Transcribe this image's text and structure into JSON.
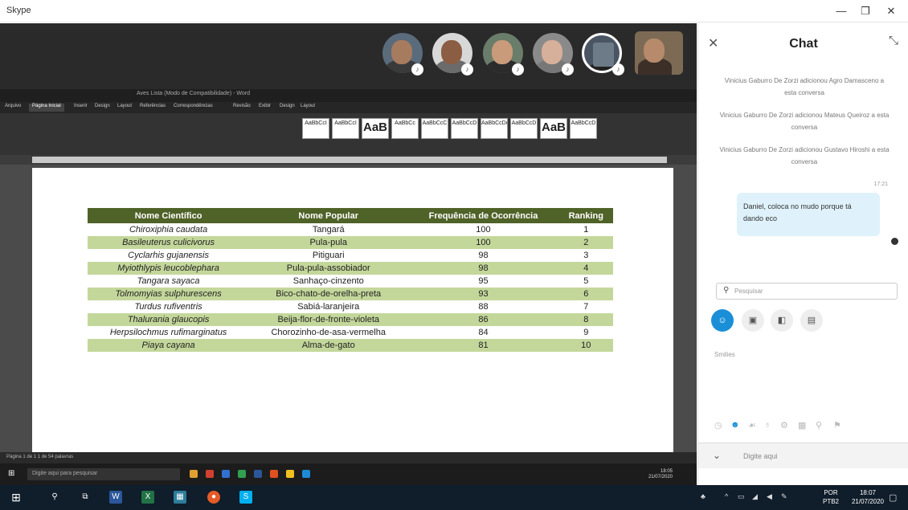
{
  "window": {
    "title": "Skype",
    "min": "—",
    "restore": "❐",
    "close": "✕"
  },
  "participants": [
    {
      "name": "participant-1",
      "active": false
    },
    {
      "name": "participant-2",
      "active": false
    },
    {
      "name": "participant-3",
      "active": false
    },
    {
      "name": "participant-4",
      "active": false
    },
    {
      "name": "participant-5",
      "active": true
    },
    {
      "name": "participant-6",
      "active": false
    }
  ],
  "word": {
    "title": "Aves Lista (Modo de Compatibilidade) - Word",
    "tabs": [
      "Arquivo",
      "Página Inicial",
      "Inserir",
      "Design",
      "Layout",
      "Referências",
      "Correspondências",
      "Revisão",
      "Exibir",
      "Design",
      "Layout"
    ],
    "styles": [
      "AaBbCcI",
      "AaBbCcI",
      "AaB",
      "AaBbCc",
      "AaBbCcC",
      "AaBbCcD",
      "AaBbCcDd",
      "AaBbCcD",
      "AaB",
      "AaBbCcD"
    ],
    "status": "Página 1 de 1   1 de 54 palavras",
    "taskbar_search": "Digite aqui para pesquisar",
    "time": "18:05",
    "date": "21/07/2020"
  },
  "table": {
    "headers": [
      "Nome Científico",
      "Nome Popular",
      "Frequência de Ocorrência",
      "Ranking"
    ],
    "rows": [
      [
        "Chiroxiphia caudata",
        "Tangará",
        "100",
        "1"
      ],
      [
        "Basileuterus culicivorus",
        "Pula-pula",
        "100",
        "2"
      ],
      [
        "Cyclarhis gujanensis",
        "Pitiguari",
        "98",
        "3"
      ],
      [
        "Myiothlypis leucoblephara",
        "Pula-pula-assobiador",
        "98",
        "4"
      ],
      [
        "Tangara sayaca",
        "Sanhaço-cinzento",
        "95",
        "5"
      ],
      [
        "Tolmomyias sulphurescens",
        "Bico-chato-de-orelha-preta",
        "93",
        "6"
      ],
      [
        "Turdus rufiventris",
        "Sabiá-laranjeira",
        "88",
        "7"
      ],
      [
        "Thalurania glaucopis",
        "Beija-flor-de-fronte-violeta",
        "86",
        "8"
      ],
      [
        "Herpsilochmus rufimarginatus",
        "Chorozinho-de-asa-vermelha",
        "84",
        "9"
      ],
      [
        "Piaya cayana",
        "Alma-de-gato",
        "81",
        "10"
      ]
    ]
  },
  "chat": {
    "title": "Chat",
    "system_messages": [
      "Vinicius Gaburro De Zorzi adicionou Agro Damasceno a esta conversa",
      "Vinicius Gaburro De Zorzi adicionou Mateus Queiroz a esta conversa",
      "Vinicius Gaburro De Zorzi adicionou Gustavo Hiroshi a esta conversa"
    ],
    "message_time": "17:21",
    "message": "Daniel, coloca no mudo porque tá dando eco",
    "search_placeholder": "Pesquisar",
    "smileys_label": "Smilies",
    "compose_placeholder": "Digite aqui"
  },
  "taskbar": {
    "lang": "POR",
    "layout": "PTB2",
    "time": "18:07",
    "date": "21/07/2020"
  },
  "colors": {
    "table_header": "#4f6228",
    "table_stripe": "#c4d79b",
    "accent": "#1a8fd8"
  }
}
